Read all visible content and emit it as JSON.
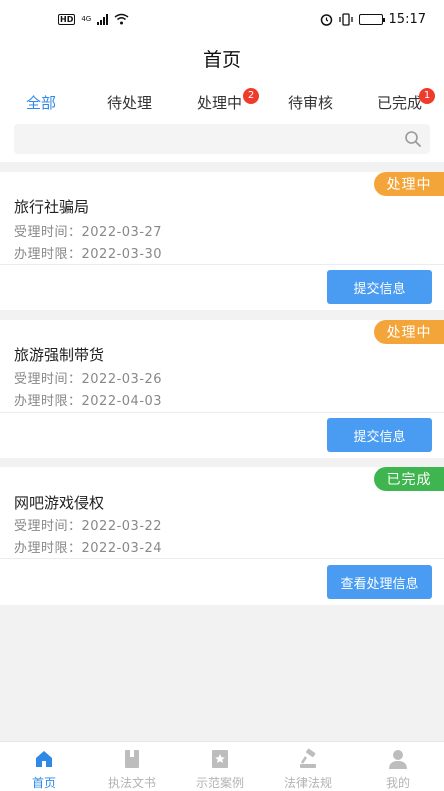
{
  "statusbar": {
    "network": "HD",
    "network_type": "4G",
    "time": "15:17"
  },
  "header": {
    "title": "首页"
  },
  "tabs": [
    {
      "label": "全部",
      "active": true,
      "badge": ""
    },
    {
      "label": "待处理",
      "active": false,
      "badge": ""
    },
    {
      "label": "处理中",
      "active": false,
      "badge": "2"
    },
    {
      "label": "待审核",
      "active": false,
      "badge": ""
    },
    {
      "label": "已完成",
      "active": false,
      "badge": "1"
    }
  ],
  "search": {
    "placeholder": "",
    "value": "",
    "icon": "search-icon"
  },
  "cases": [
    {
      "title": "旅行社骗局",
      "accept_label": "受理时间：",
      "accept_date": "2022-03-27",
      "deadline_label": "办理时限：",
      "deadline_date": "2022-03-30",
      "status": "处理中",
      "action": "提交信息"
    },
    {
      "title": "旅游强制带货",
      "accept_label": "受理时间：",
      "accept_date": "2022-03-26",
      "deadline_label": "办理时限：",
      "deadline_date": "2022-04-03",
      "status": "处理中",
      "action": "提交信息"
    },
    {
      "title": "网吧游戏侵权",
      "accept_label": "受理时间：",
      "accept_date": "2022-03-22",
      "deadline_label": "办理时限：",
      "deadline_date": "2022-03-24",
      "status": "已完成",
      "action": "查看处理信息"
    }
  ],
  "colors": {
    "accent": "#2e8ae6",
    "processing": "#f4a53a",
    "done": "#3fb54f",
    "button": "#4a9cf2",
    "badge": "#ef3b2c"
  },
  "tabbar": [
    {
      "label": "首页",
      "icon": "home-icon",
      "active": true
    },
    {
      "label": "执法文书",
      "icon": "book-icon",
      "active": false
    },
    {
      "label": "示范案例",
      "icon": "star-doc-icon",
      "active": false
    },
    {
      "label": "法律法规",
      "icon": "gavel-icon",
      "active": false
    },
    {
      "label": "我的",
      "icon": "user-icon",
      "active": false
    }
  ]
}
